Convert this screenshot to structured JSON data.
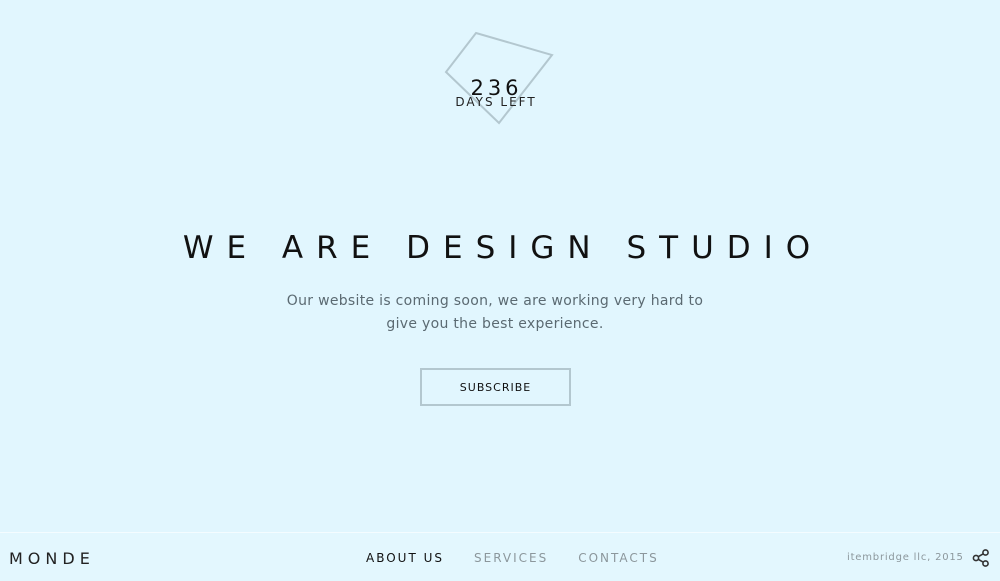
{
  "countdown": {
    "number": "236",
    "label": "DAYS LEFT"
  },
  "hero": {
    "headline": "WE ARE DESIGN STUDIO",
    "subtext": "Our website is coming soon, we are working very hard to give you the best experience.",
    "subscribe_label": "SUBSCRIBE"
  },
  "footer": {
    "brand": "MONDE",
    "nav": [
      {
        "label": "ABOUT US",
        "active": true
      },
      {
        "label": "SERVICES",
        "active": false
      },
      {
        "label": "CONTACTS",
        "active": false
      }
    ],
    "copyright": "itembridge llc, 2015",
    "share_icon": "share-icon"
  },
  "colors": {
    "background": "#e1f6fe",
    "outline": "#b3c7cf",
    "text_dark": "#111111",
    "text_muted": "#8c979c"
  }
}
